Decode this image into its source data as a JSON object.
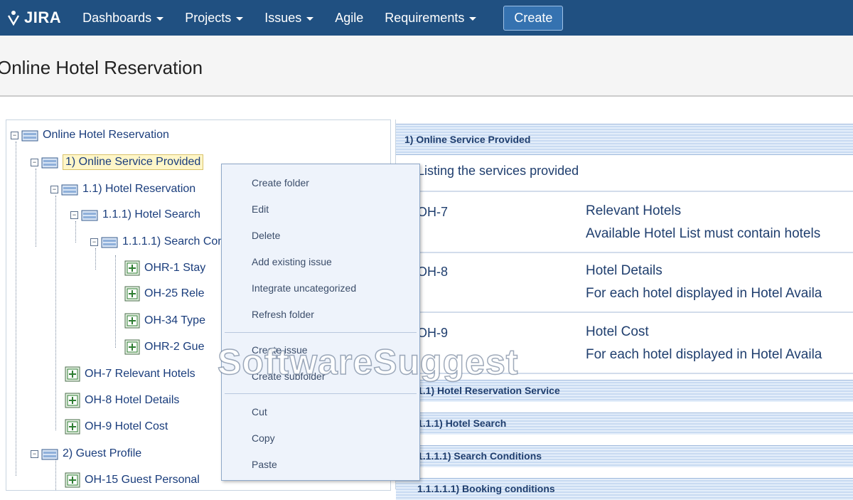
{
  "nav": {
    "logo": "JIRA",
    "items": [
      {
        "label": "Dashboards",
        "caret": true
      },
      {
        "label": "Projects",
        "caret": true
      },
      {
        "label": "Issues",
        "caret": true
      },
      {
        "label": "Agile",
        "caret": false
      },
      {
        "label": "Requirements",
        "caret": true
      }
    ],
    "create_label": "Create"
  },
  "page": {
    "title": "Online Hotel Reservation"
  },
  "tree": {
    "root": "Online Hotel Reservation",
    "n1": "1) Online Service Provided",
    "n1_1": "1.1) Hotel Reservation",
    "n1_1_1": "1.1.1) Hotel Search",
    "n1_1_1_1": "1.1.1.1) Search Conditions",
    "issues_a": [
      "OHR-1 Stay",
      "OH-25 Rele",
      "OH-34 Type",
      "OHR-2 Gue"
    ],
    "issues_b": [
      "OH-7 Relevant Hotels",
      "OH-8 Hotel Details",
      "OH-9 Hotel Cost"
    ],
    "n2": "2) Guest Profile",
    "issue_c": "OH-15 Guest Personal"
  },
  "context_menu": {
    "group1": [
      "Create folder",
      "Edit",
      "Delete",
      "Add existing issue",
      "Integrate uncategorized",
      "Refresh folder"
    ],
    "group2": [
      "Create issue",
      "Create subfolder"
    ],
    "group3": [
      "Cut",
      "Copy",
      "Paste"
    ]
  },
  "right_panel": {
    "header": "1) Online Service Provided",
    "description": "Listing the services provided",
    "rows": [
      {
        "key": "OH-7",
        "summary": "Relevant Hotels",
        "text": "Available Hotel List must contain hotels"
      },
      {
        "key": "OH-8",
        "summary": "Hotel Details",
        "text": "For each hotel displayed in Hotel Availa"
      },
      {
        "key": "OH-9",
        "summary": "Hotel Cost",
        "text": "For each hotel displayed in Hotel Availa"
      }
    ],
    "sections": [
      "1.1) Hotel Reservation Service",
      "1.1.1) Hotel Search",
      "1.1.1.1) Search Conditions",
      "1.1.1.1.1) Booking conditions"
    ]
  },
  "watermark": "SoftwareSuggest",
  "colors": {
    "nav_bg": "#205081",
    "accent": "#3572b0"
  }
}
